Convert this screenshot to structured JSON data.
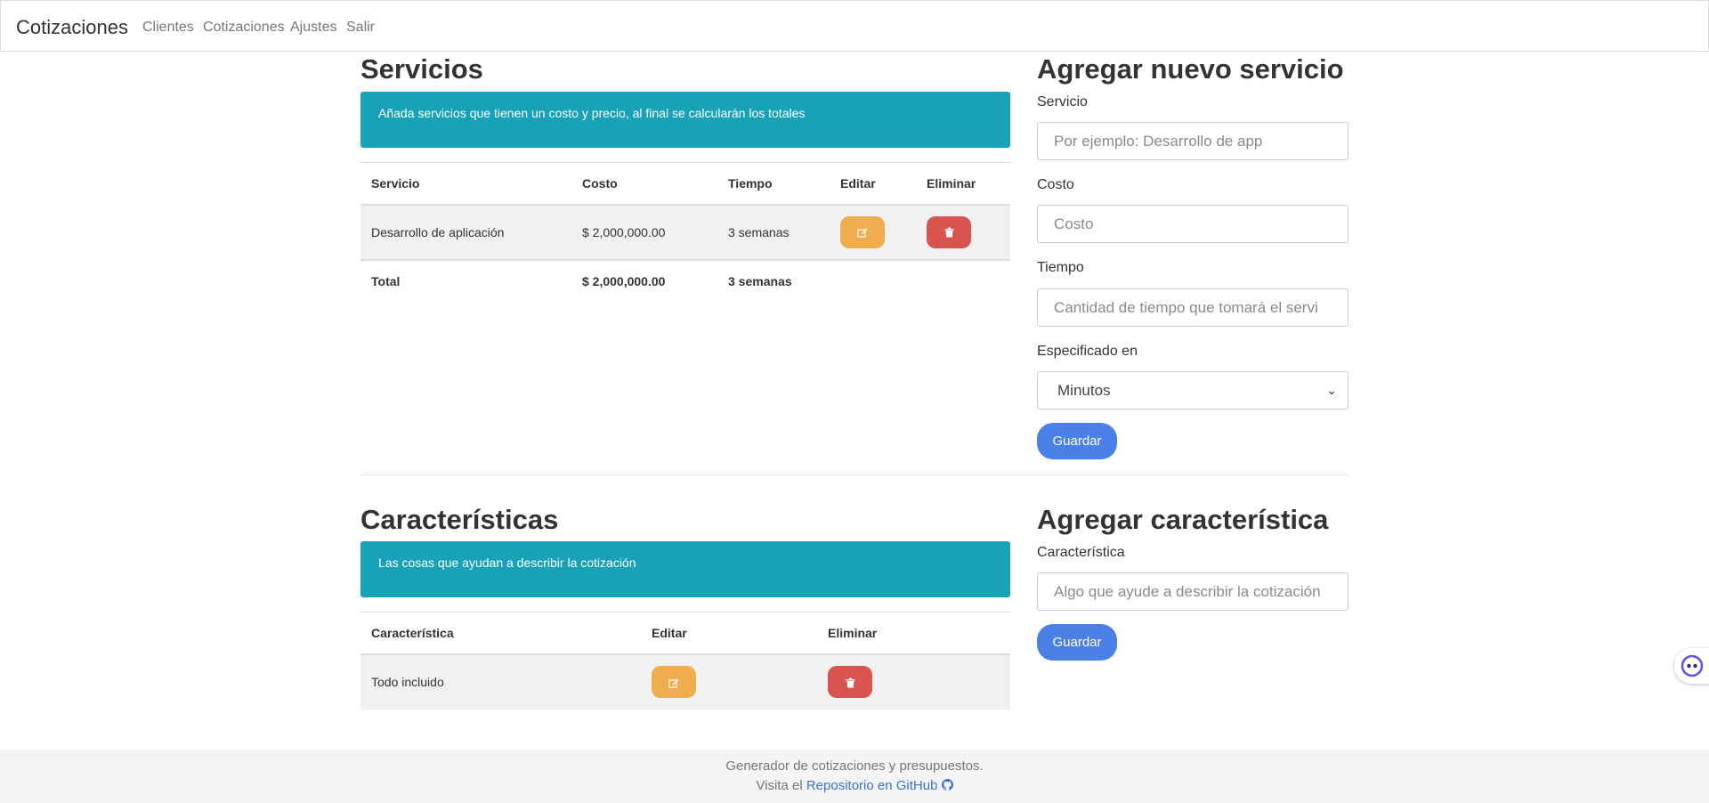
{
  "nav": {
    "brand": "Cotizaciones",
    "links": [
      "Clientes",
      "Cotizaciones",
      "Ajustes",
      "Salir"
    ]
  },
  "servicios": {
    "title": "Servicios",
    "alert": "Añada servicios que tienen un costo y precio, al final se calcularán los totales",
    "headers": [
      "Servicio",
      "Costo",
      "Tiempo",
      "Editar",
      "Eliminar"
    ],
    "rows": [
      {
        "servicio": "Desarrollo de aplicación",
        "costo": "$ 2,000,000.00",
        "tiempo": "3 semanas"
      }
    ],
    "total": {
      "label": "Total",
      "costo": "$ 2,000,000.00",
      "tiempo": "3 semanas"
    }
  },
  "nuevo_servicio": {
    "title": "Agregar nuevo servicio",
    "servicio_label": "Servicio",
    "servicio_placeholder": "Por ejemplo: Desarrollo de app",
    "costo_label": "Costo",
    "costo_placeholder": "Costo",
    "tiempo_label": "Tiempo",
    "tiempo_placeholder": "Cantidad de tiempo que tomará el servi",
    "especificado_label": "Especificado en",
    "especificado_value": "Minutos",
    "save": "Guardar"
  },
  "caracteristicas": {
    "title": "Características",
    "alert": "Las cosas que ayudan a describir la cotización",
    "headers": [
      "Característica",
      "Editar",
      "Eliminar"
    ],
    "rows": [
      {
        "caracteristica": "Todo incluido"
      }
    ]
  },
  "nueva_caracteristica": {
    "title": "Agregar característica",
    "label": "Característica",
    "placeholder": "Algo que ayude a describir la cotización",
    "save": "Guardar"
  },
  "footer": {
    "line1": "Generador de cotizaciones y presupuestos.",
    "visit": "Visita el",
    "repo_link": "Repositorio en GitHub"
  },
  "icons": {
    "edit": "edit-icon",
    "delete": "trash-icon",
    "github": "github-icon",
    "bot": "assistant-bot-icon"
  },
  "colors": {
    "info": "#17a2b8",
    "warning": "#f0ad4e",
    "danger": "#d9534f",
    "primary": "#4a80e8"
  }
}
